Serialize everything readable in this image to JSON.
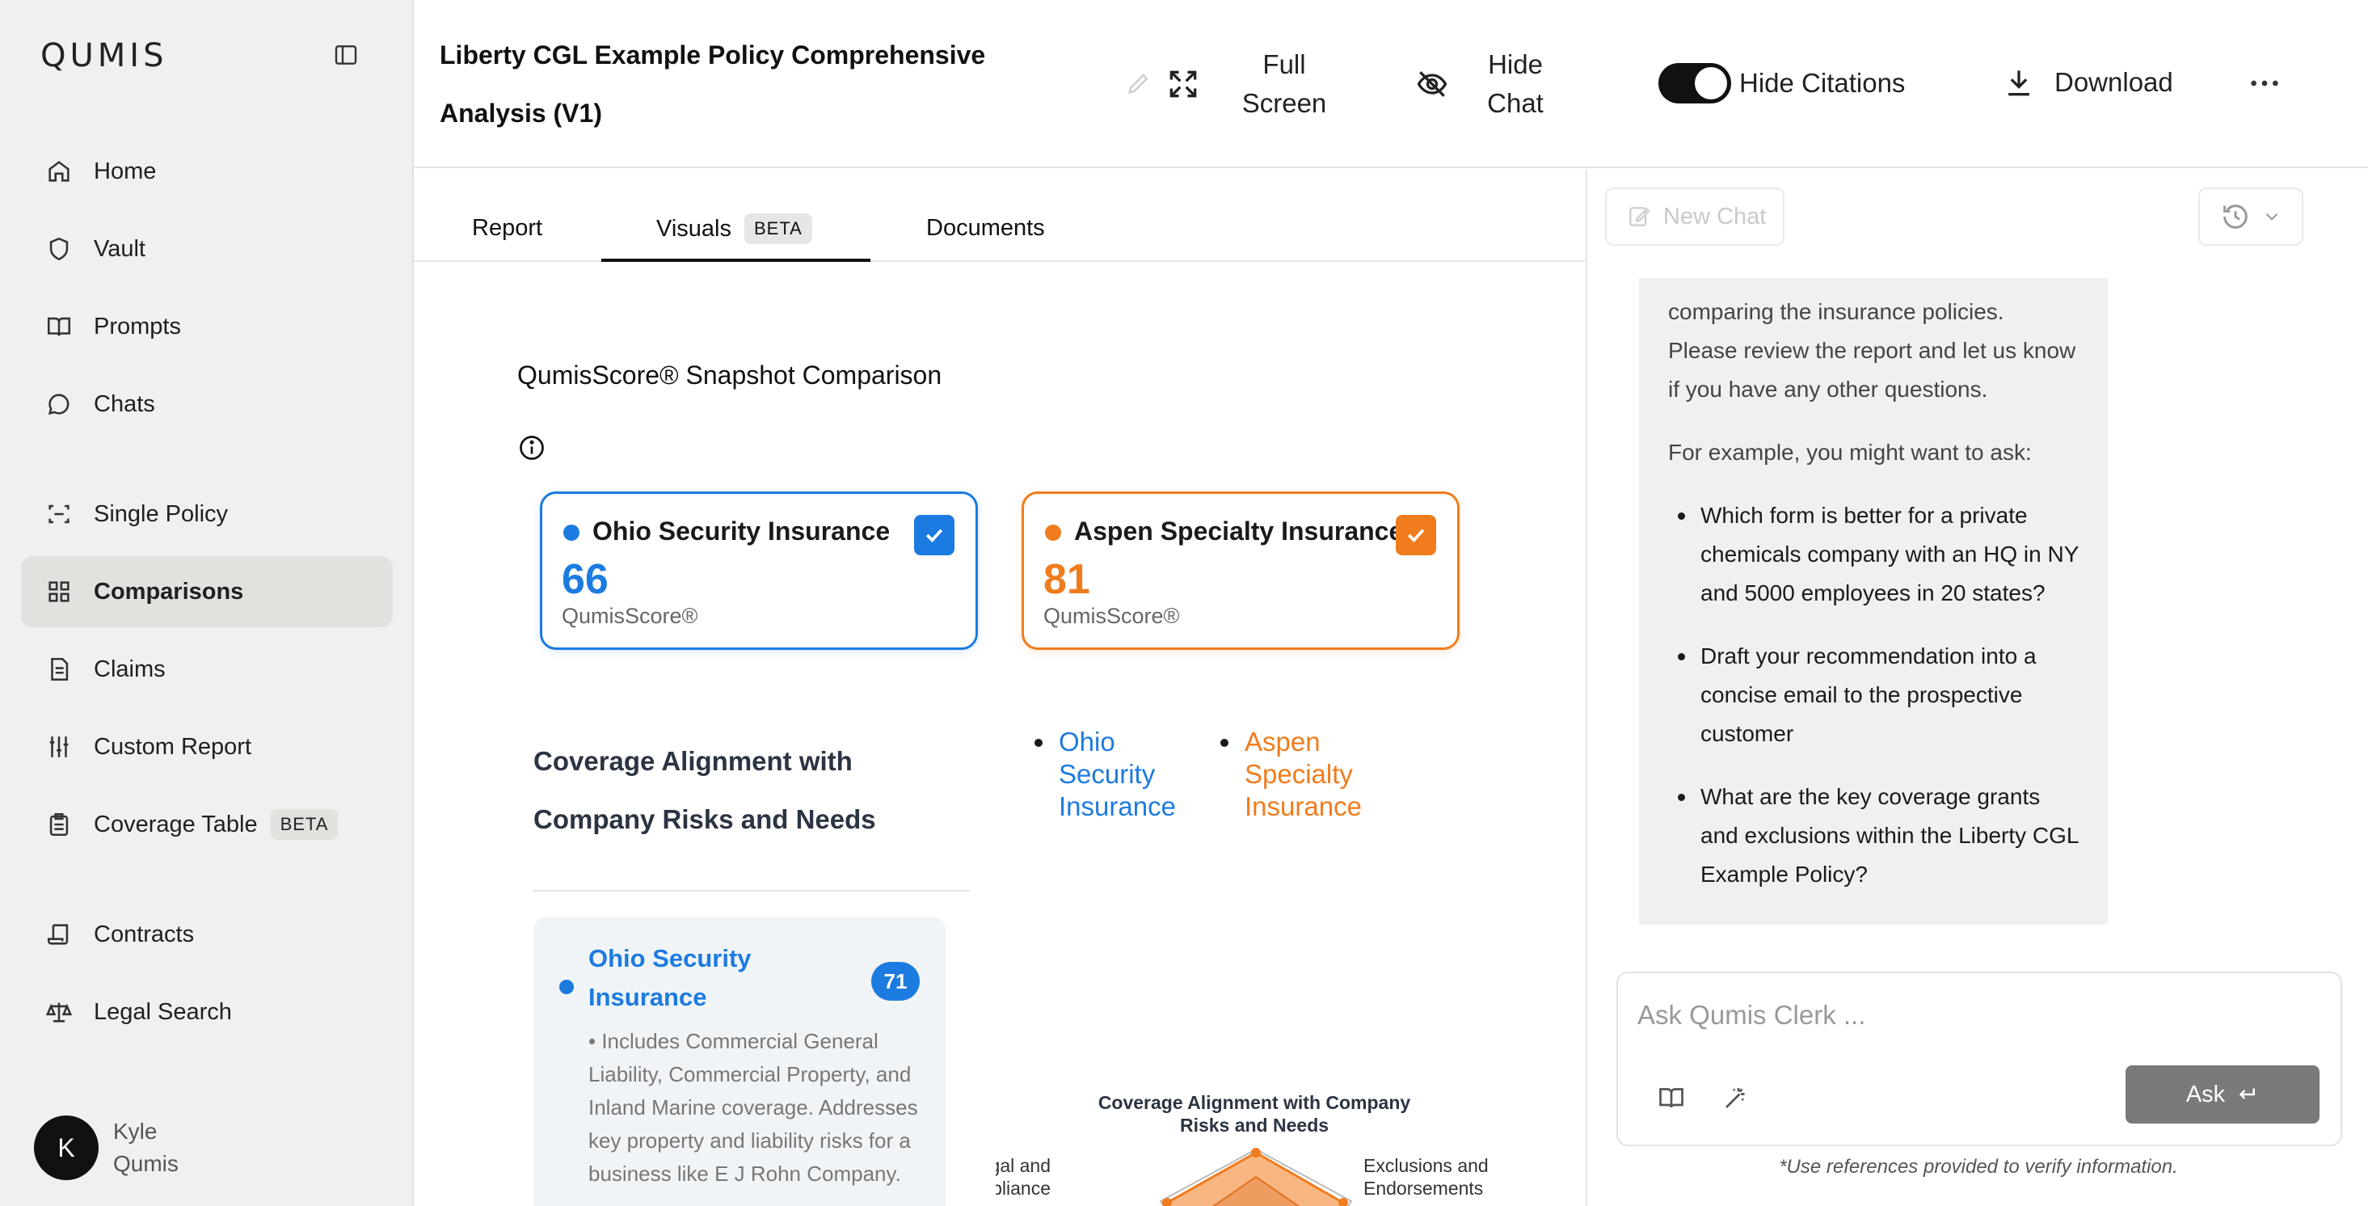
{
  "sidebar": {
    "logo": "QUMIS",
    "items": [
      {
        "label": "Home",
        "icon": "home-icon"
      },
      {
        "label": "Vault",
        "icon": "shield-icon"
      },
      {
        "label": "Prompts",
        "icon": "book-icon"
      },
      {
        "label": "Chats",
        "icon": "chat-bubble-icon"
      },
      {
        "label": "Single Policy",
        "icon": "scan-icon"
      },
      {
        "label": "Comparisons",
        "icon": "grid-icon"
      },
      {
        "label": "Claims",
        "icon": "document-icon"
      },
      {
        "label": "Custom Report",
        "icon": "sliders-icon"
      },
      {
        "label": "Coverage Table",
        "icon": "clipboard-icon",
        "badge": "BETA"
      },
      {
        "label": "Contracts",
        "icon": "scroll-icon"
      },
      {
        "label": "Legal Search",
        "icon": "scales-icon"
      }
    ],
    "active": "Comparisons",
    "user": {
      "initial": "K",
      "name": "Kyle Qumis"
    }
  },
  "header": {
    "title": "Liberty CGL Example Policy Comprehensive Analysis (V1)",
    "full_screen": "Full Screen",
    "hide_chat": "Hide Chat",
    "hide_citations": "Hide Citations",
    "hide_citations_on": true,
    "download": "Download"
  },
  "tabs": {
    "report": "Report",
    "visuals": "Visuals",
    "visuals_badge": "BETA",
    "documents": "Documents",
    "active": "Visuals"
  },
  "main": {
    "snapshot_title": "QumisScore® Snapshot Comparison",
    "cards": [
      {
        "name": "Ohio Security Insurance",
        "score": "66",
        "label": "QumisScore®",
        "color": "#1c7be0",
        "checked": true
      },
      {
        "name": "Aspen Specialty Insurance",
        "score": "81",
        "label": "QumisScore®",
        "color": "#f07c1d",
        "checked": true
      }
    ],
    "section_title": "Coverage Alignment with Company Risks and Needs",
    "legend": [
      "Ohio Security Insurance",
      "Aspen Specialty Insurance"
    ],
    "detail": {
      "title": "Ohio Security Insurance",
      "score": "71",
      "text": "• Includes Commercial General Liability, Commercial Property, and Inland Marine coverage. Addresses key property and liability risks for a business like E J Rohn Company."
    },
    "radar": {
      "title": "Coverage Alignment with Company Risks and Needs",
      "axis_left": "Legal and ory Compliance",
      "axis_right": "Exclusions and Endorsements"
    }
  },
  "chat": {
    "new_chat": "New Chat",
    "intro": "comparing the insurance policies. Please review the report and let us know if you have any other questions.",
    "example_lead": "For example, you might want to ask:",
    "examples": [
      "Which form is better for a private chemicals company with an HQ in NY and 5000 employees in 20 states?",
      "Draft your recommendation into a concise email to the prospective customer",
      "What are the key coverage grants and exclusions within the Liberty CGL Example Policy?"
    ],
    "input_placeholder": "Ask Qumis Clerk ...",
    "ask": "Ask",
    "disclaimer": "*Use references provided to verify information."
  }
}
